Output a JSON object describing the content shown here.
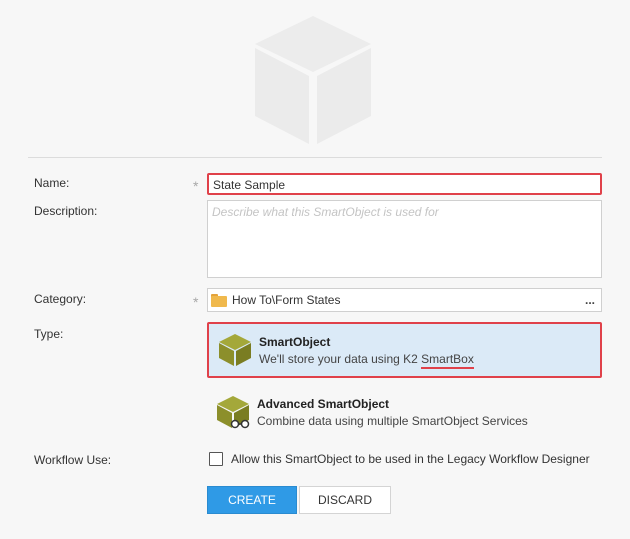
{
  "form": {
    "name_label": "Name:",
    "name_value": "State Sample",
    "description_label": "Description:",
    "description_placeholder": "Describe what this SmartObject is used for",
    "category_label": "Category:",
    "category_value": "How To\\Form States",
    "category_browse": "...",
    "type_label": "Type:",
    "workflow_label": "Workflow Use:",
    "required_mark": "*"
  },
  "types": {
    "smartobject": {
      "title": "SmartObject",
      "desc_prefix": "We'll store your data using K2 ",
      "desc_highlight": "SmartBox"
    },
    "advanced": {
      "title": "Advanced SmartObject",
      "desc": "Combine data using multiple SmartObject Services"
    }
  },
  "workflow": {
    "checkbox_label": "Allow this SmartObject to be used in the Legacy Workflow Designer",
    "checked": false
  },
  "buttons": {
    "create": "CREATE",
    "discard": "DISCARD"
  },
  "colors": {
    "accent": "#2f9ae6",
    "highlight_border": "#e0414a",
    "selected_bg": "#dbeaf7",
    "cube_olive": "#8c8f2b"
  },
  "icons": {
    "hero": "smartobject-cube-placeholder-icon",
    "folder": "folder-icon",
    "smartobject": "smartobject-cube-icon",
    "advanced": "advanced-smartobject-cube-icon"
  }
}
